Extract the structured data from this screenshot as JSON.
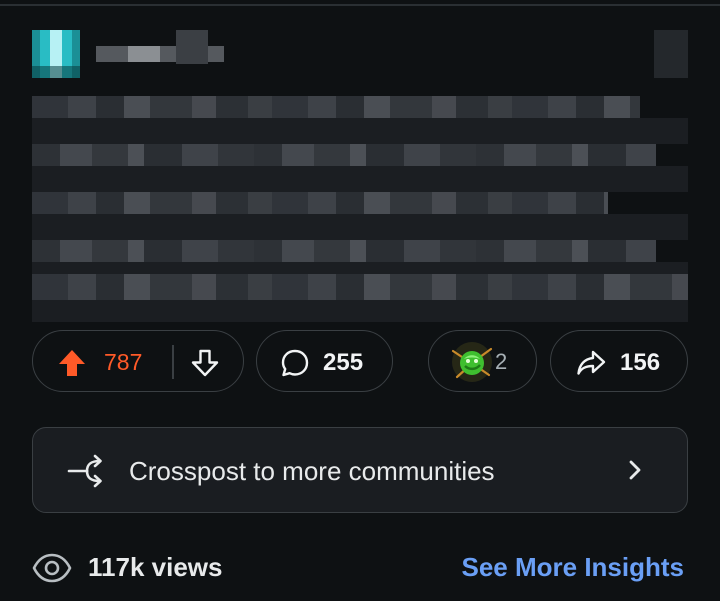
{
  "post": {
    "upvote_count": "787",
    "comment_count": "255",
    "award_count": "2",
    "share_count": "156"
  },
  "crosspost": {
    "label": "Crosspost to more communities"
  },
  "footer": {
    "views": "117k views",
    "insights_link": "See More Insights"
  },
  "colors": {
    "background": "#0e1113",
    "upvote_active": "#ff5a28",
    "insights_link": "#6a9ff5",
    "pill_border": "#3a3f43"
  },
  "icons": {
    "upvote": "arrow-up-filled-icon",
    "downvote": "arrow-down-outline-icon",
    "comment": "speech-bubble-icon",
    "award": "green-award-icon",
    "share": "share-arrow-icon",
    "crosspost": "crosspost-arrows-icon",
    "chevron": "chevron-right-icon",
    "views": "eye-icon"
  }
}
